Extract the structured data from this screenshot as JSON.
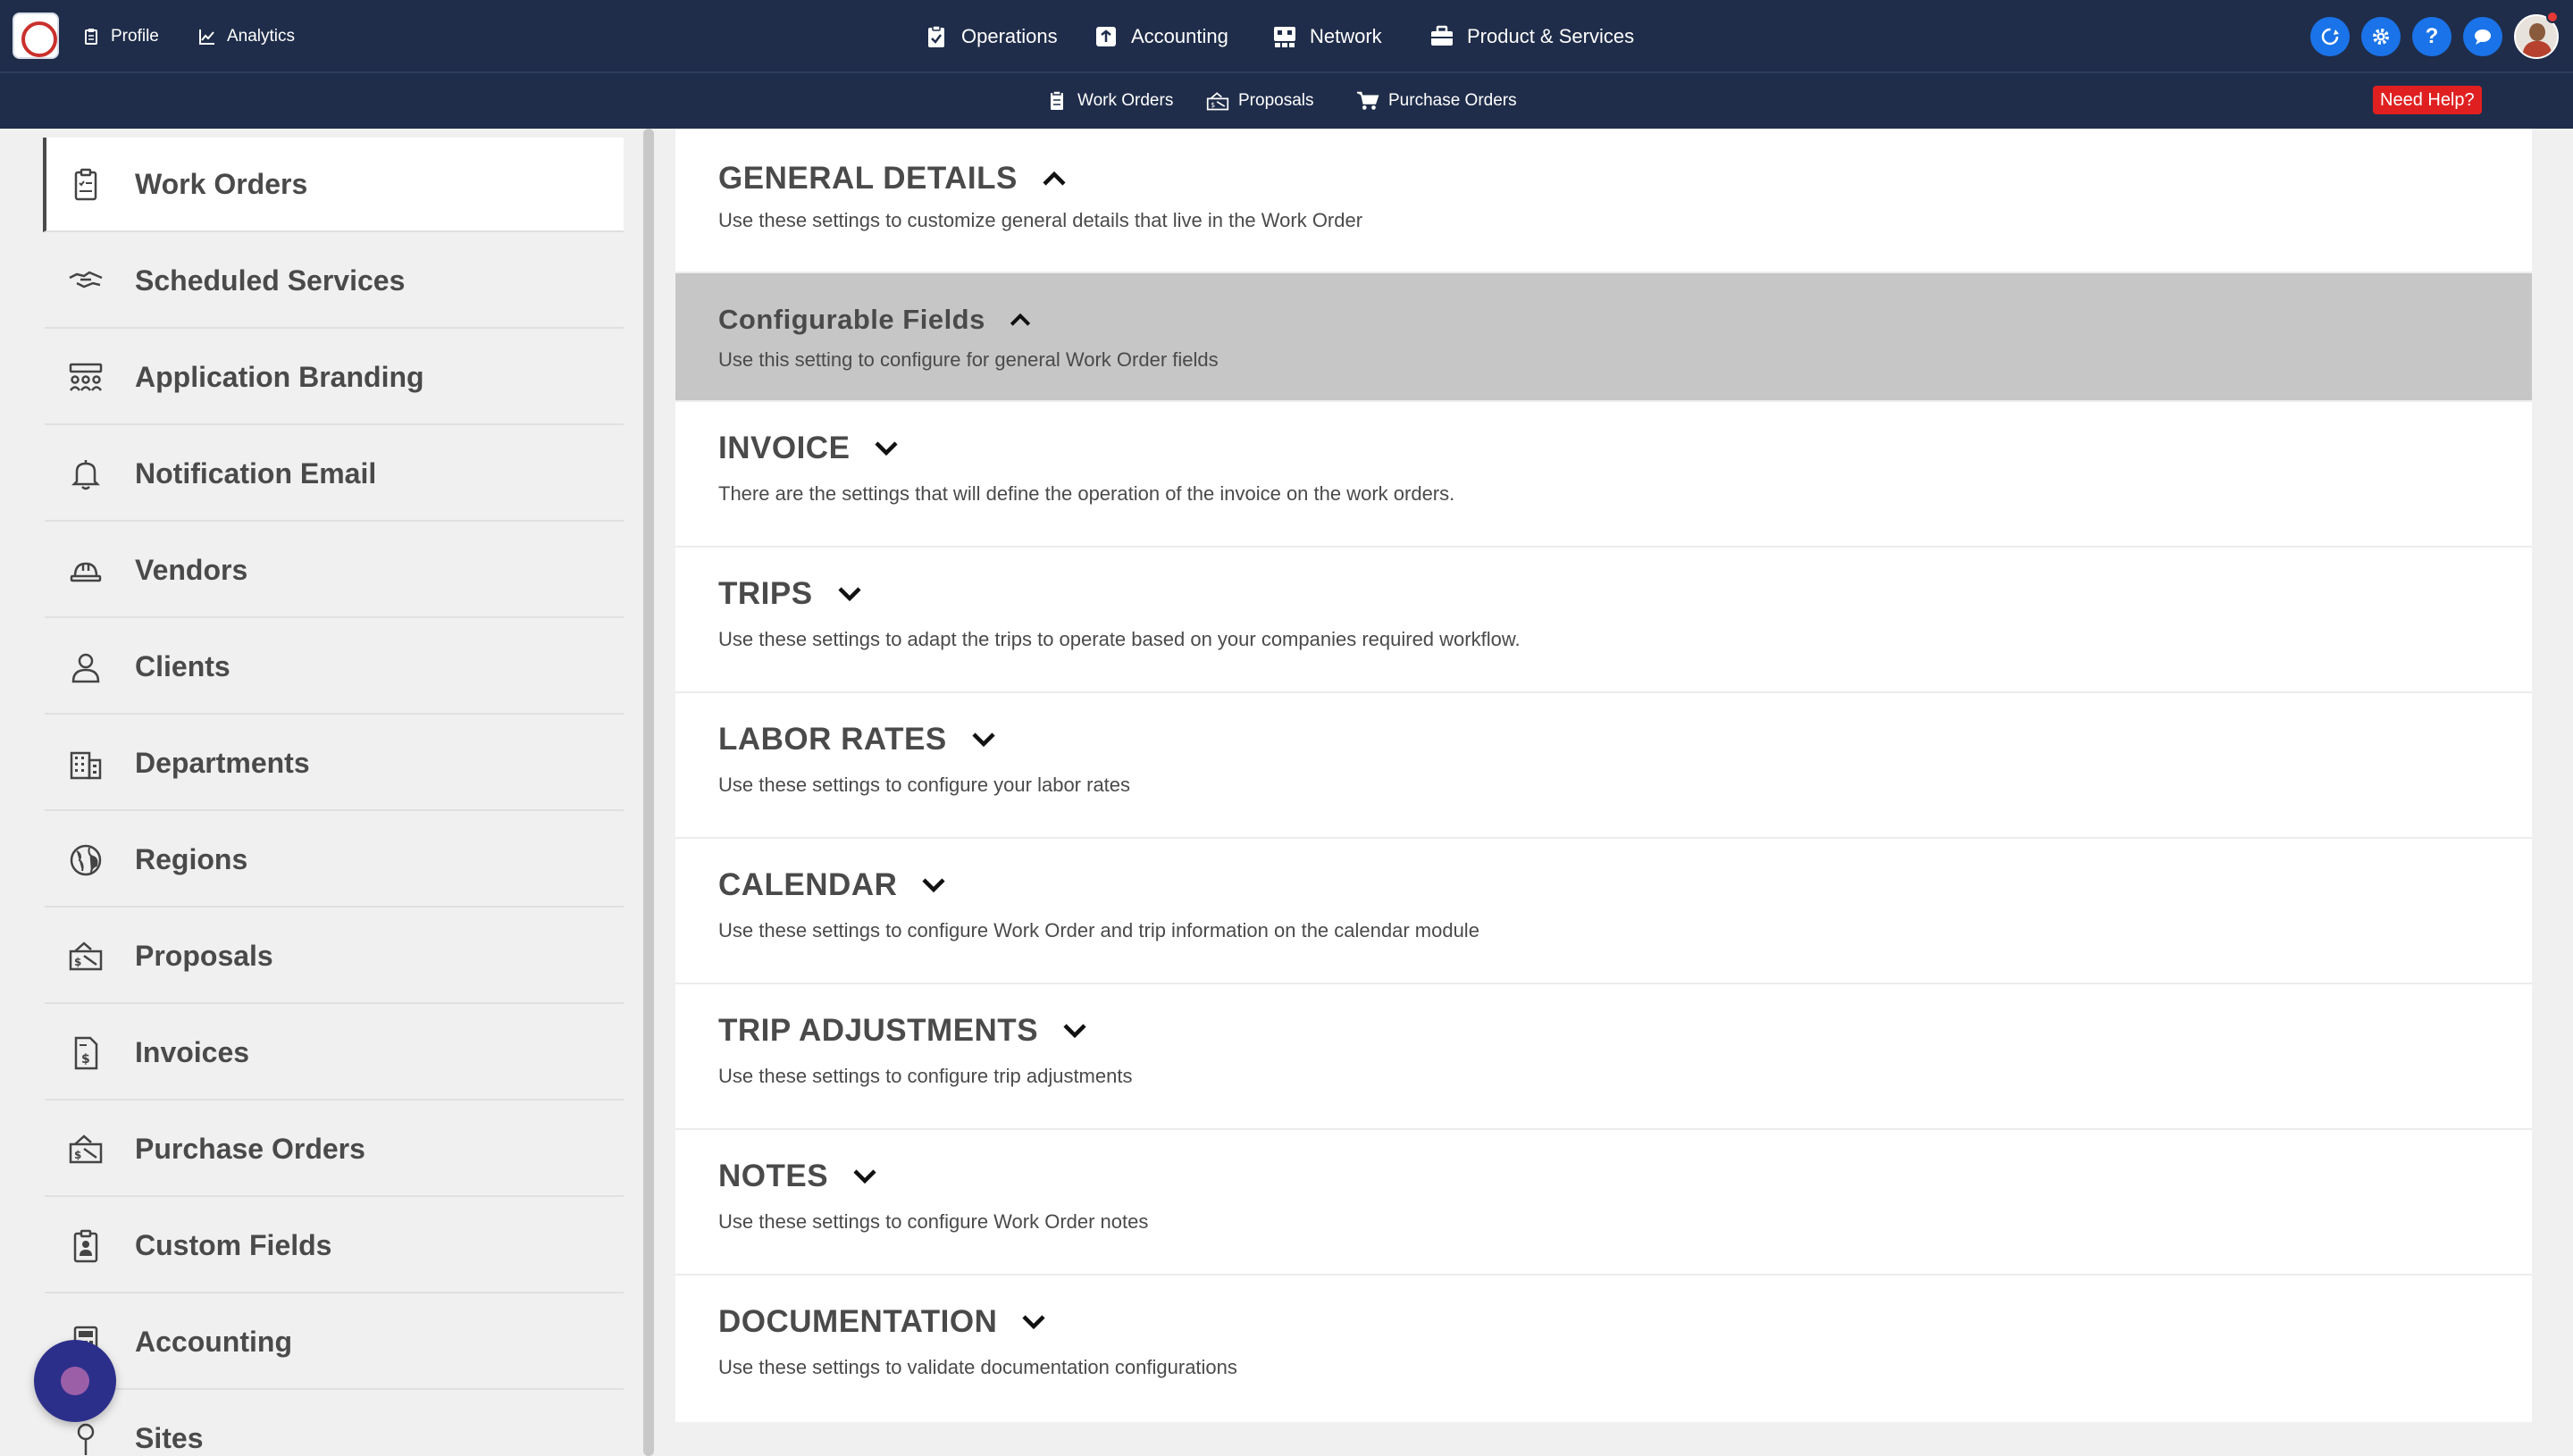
{
  "topbar": {
    "left": [
      {
        "label": "Profile",
        "icon": "clipboard-icon"
      },
      {
        "label": "Analytics",
        "icon": "chart-line-icon"
      }
    ],
    "center": [
      {
        "label": "Operations",
        "icon": "clipboard-check-icon"
      },
      {
        "label": "Accounting",
        "icon": "calculator-icon"
      },
      {
        "label": "Network",
        "icon": "network-icon"
      },
      {
        "label": "Product & Services",
        "icon": "briefcase-icon"
      }
    ],
    "right_help": "?",
    "accent": "#1a73e8",
    "background": "#1f2d4a"
  },
  "subbar": {
    "items": [
      {
        "label": "Work Orders",
        "icon": "clipboard-icon"
      },
      {
        "label": "Proposals",
        "icon": "proposal-icon"
      },
      {
        "label": "Purchase Orders",
        "icon": "cart-icon"
      }
    ],
    "need_help": "Need Help?"
  },
  "sidebar": {
    "items": [
      {
        "label": "Work Orders",
        "icon": "clipboard-list-icon",
        "active": true
      },
      {
        "label": "Scheduled Services",
        "icon": "handshake-icon"
      },
      {
        "label": "Application Branding",
        "icon": "people-group-icon"
      },
      {
        "label": "Notification Email",
        "icon": "bell-icon"
      },
      {
        "label": "Vendors",
        "icon": "hard-hat-icon"
      },
      {
        "label": "Clients",
        "icon": "user-icon"
      },
      {
        "label": "Departments",
        "icon": "building-icon"
      },
      {
        "label": "Regions",
        "icon": "globe-icon"
      },
      {
        "label": "Proposals",
        "icon": "proposal-icon"
      },
      {
        "label": "Invoices",
        "icon": "invoice-icon"
      },
      {
        "label": "Purchase Orders",
        "icon": "proposal-icon"
      },
      {
        "label": "Custom Fields",
        "icon": "clipboard-person-icon"
      },
      {
        "label": "Accounting",
        "icon": "calculator-icon"
      },
      {
        "label": "Sites",
        "icon": "pin-icon"
      }
    ]
  },
  "main": {
    "sections": [
      {
        "title": "GENERAL DETAILS",
        "subtitle": "Use these settings to customize general details that live in the Work Order",
        "expanded": true
      },
      {
        "title": "Configurable Fields",
        "subtitle": "Use this setting to configure for general Work Order fields",
        "expanded": true,
        "highlight": true
      },
      {
        "title": "INVOICE",
        "subtitle": "There are the settings that will define the operation of the invoice on the work orders.",
        "expanded": false
      },
      {
        "title": "TRIPS",
        "subtitle": "Use these settings to adapt the trips to operate based on your companies required workflow.",
        "expanded": false
      },
      {
        "title": "LABOR RATES",
        "subtitle": "Use these settings to configure your labor rates",
        "expanded": false
      },
      {
        "title": "CALENDAR",
        "subtitle": "Use these settings to configure Work Order and trip information on the calendar module",
        "expanded": false
      },
      {
        "title": "TRIP ADJUSTMENTS",
        "subtitle": "Use these settings to configure trip adjustments",
        "expanded": false
      },
      {
        "title": "NOTES",
        "subtitle": "Use these settings to configure Work Order notes",
        "expanded": false
      },
      {
        "title": "DOCUMENTATION",
        "subtitle": "Use these settings to validate documentation configurations",
        "expanded": false
      }
    ]
  }
}
